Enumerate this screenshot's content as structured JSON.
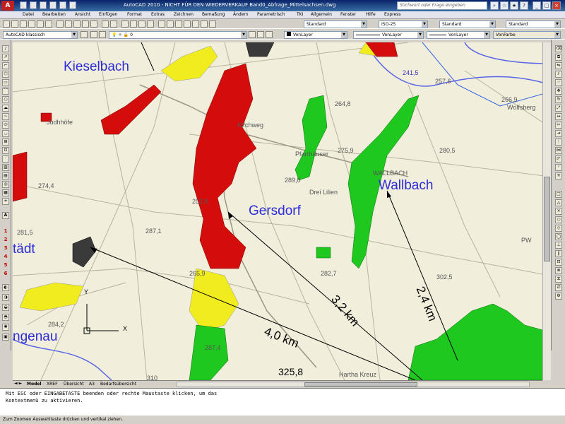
{
  "titlebar": {
    "title": "AutoCAD 2010 - NICHT FÜR DEN WIEDERVERKAUF     Band0_Abfrage_Mittelsachsen.dwg",
    "search_placeholder": "Stichwort oder Frage eingeben"
  },
  "menu": [
    "Datei",
    "Bearbeiten",
    "Ansicht",
    "Einfügen",
    "Format",
    "Extras",
    "Zeichnen",
    "Bemaßung",
    "Ändern",
    "Parametrisch",
    "TKI",
    "Allgemein",
    "Fenster",
    "Hilfe",
    "Express"
  ],
  "toolbar": {
    "textstyle": "Standard",
    "dimstyle": "ISO-25",
    "tablestyle": "Standard",
    "mleaderstyle": "Standard",
    "workspace": "AutoCAD klassisch",
    "layer": "0",
    "color": "VonLayer",
    "linetype": "VonLayer",
    "lineweight": "VonLayer",
    "plotstyle": "VonFarbe"
  },
  "left_toolbar_numbers": [
    "1",
    "2",
    "3",
    "4",
    "5",
    "6"
  ],
  "map": {
    "places": [
      "Kieselbach",
      "Gersdorf",
      "Wallbach",
      "tädt",
      "ngenau"
    ],
    "distances": [
      "4,0 km",
      "3,2 km",
      "2,4 km"
    ],
    "heights": [
      "241,5",
      "257,6",
      "264,8",
      "266,9",
      "275,9",
      "280,5",
      "289,0",
      "274,4",
      "281,5",
      "287,1",
      "282,7",
      "302,5",
      "284,2",
      "287,4",
      "325,8",
      "252,8",
      "265,9",
      "310"
    ],
    "small_labels": [
      "Judhhöfe",
      "WALLBACH",
      "Drei Lilien",
      "Wolfsberg",
      "Pfarrhäuser",
      "Kirchweg",
      "Hartha Kreuz",
      "PW",
      "X",
      "Y"
    ]
  },
  "tabs": [
    "Model",
    "XREF",
    "Übersicht",
    "A3",
    "Bedarfsübersicht"
  ],
  "command_lines": [
    "Mit ESC oder EINGABETASTE beenden oder rechte Maustaste klicken, um das",
    "Kontextmenü zu aktivieren."
  ],
  "status_text": "Zum Zoomen Auswahltaste drücken und vertikal ziehen."
}
